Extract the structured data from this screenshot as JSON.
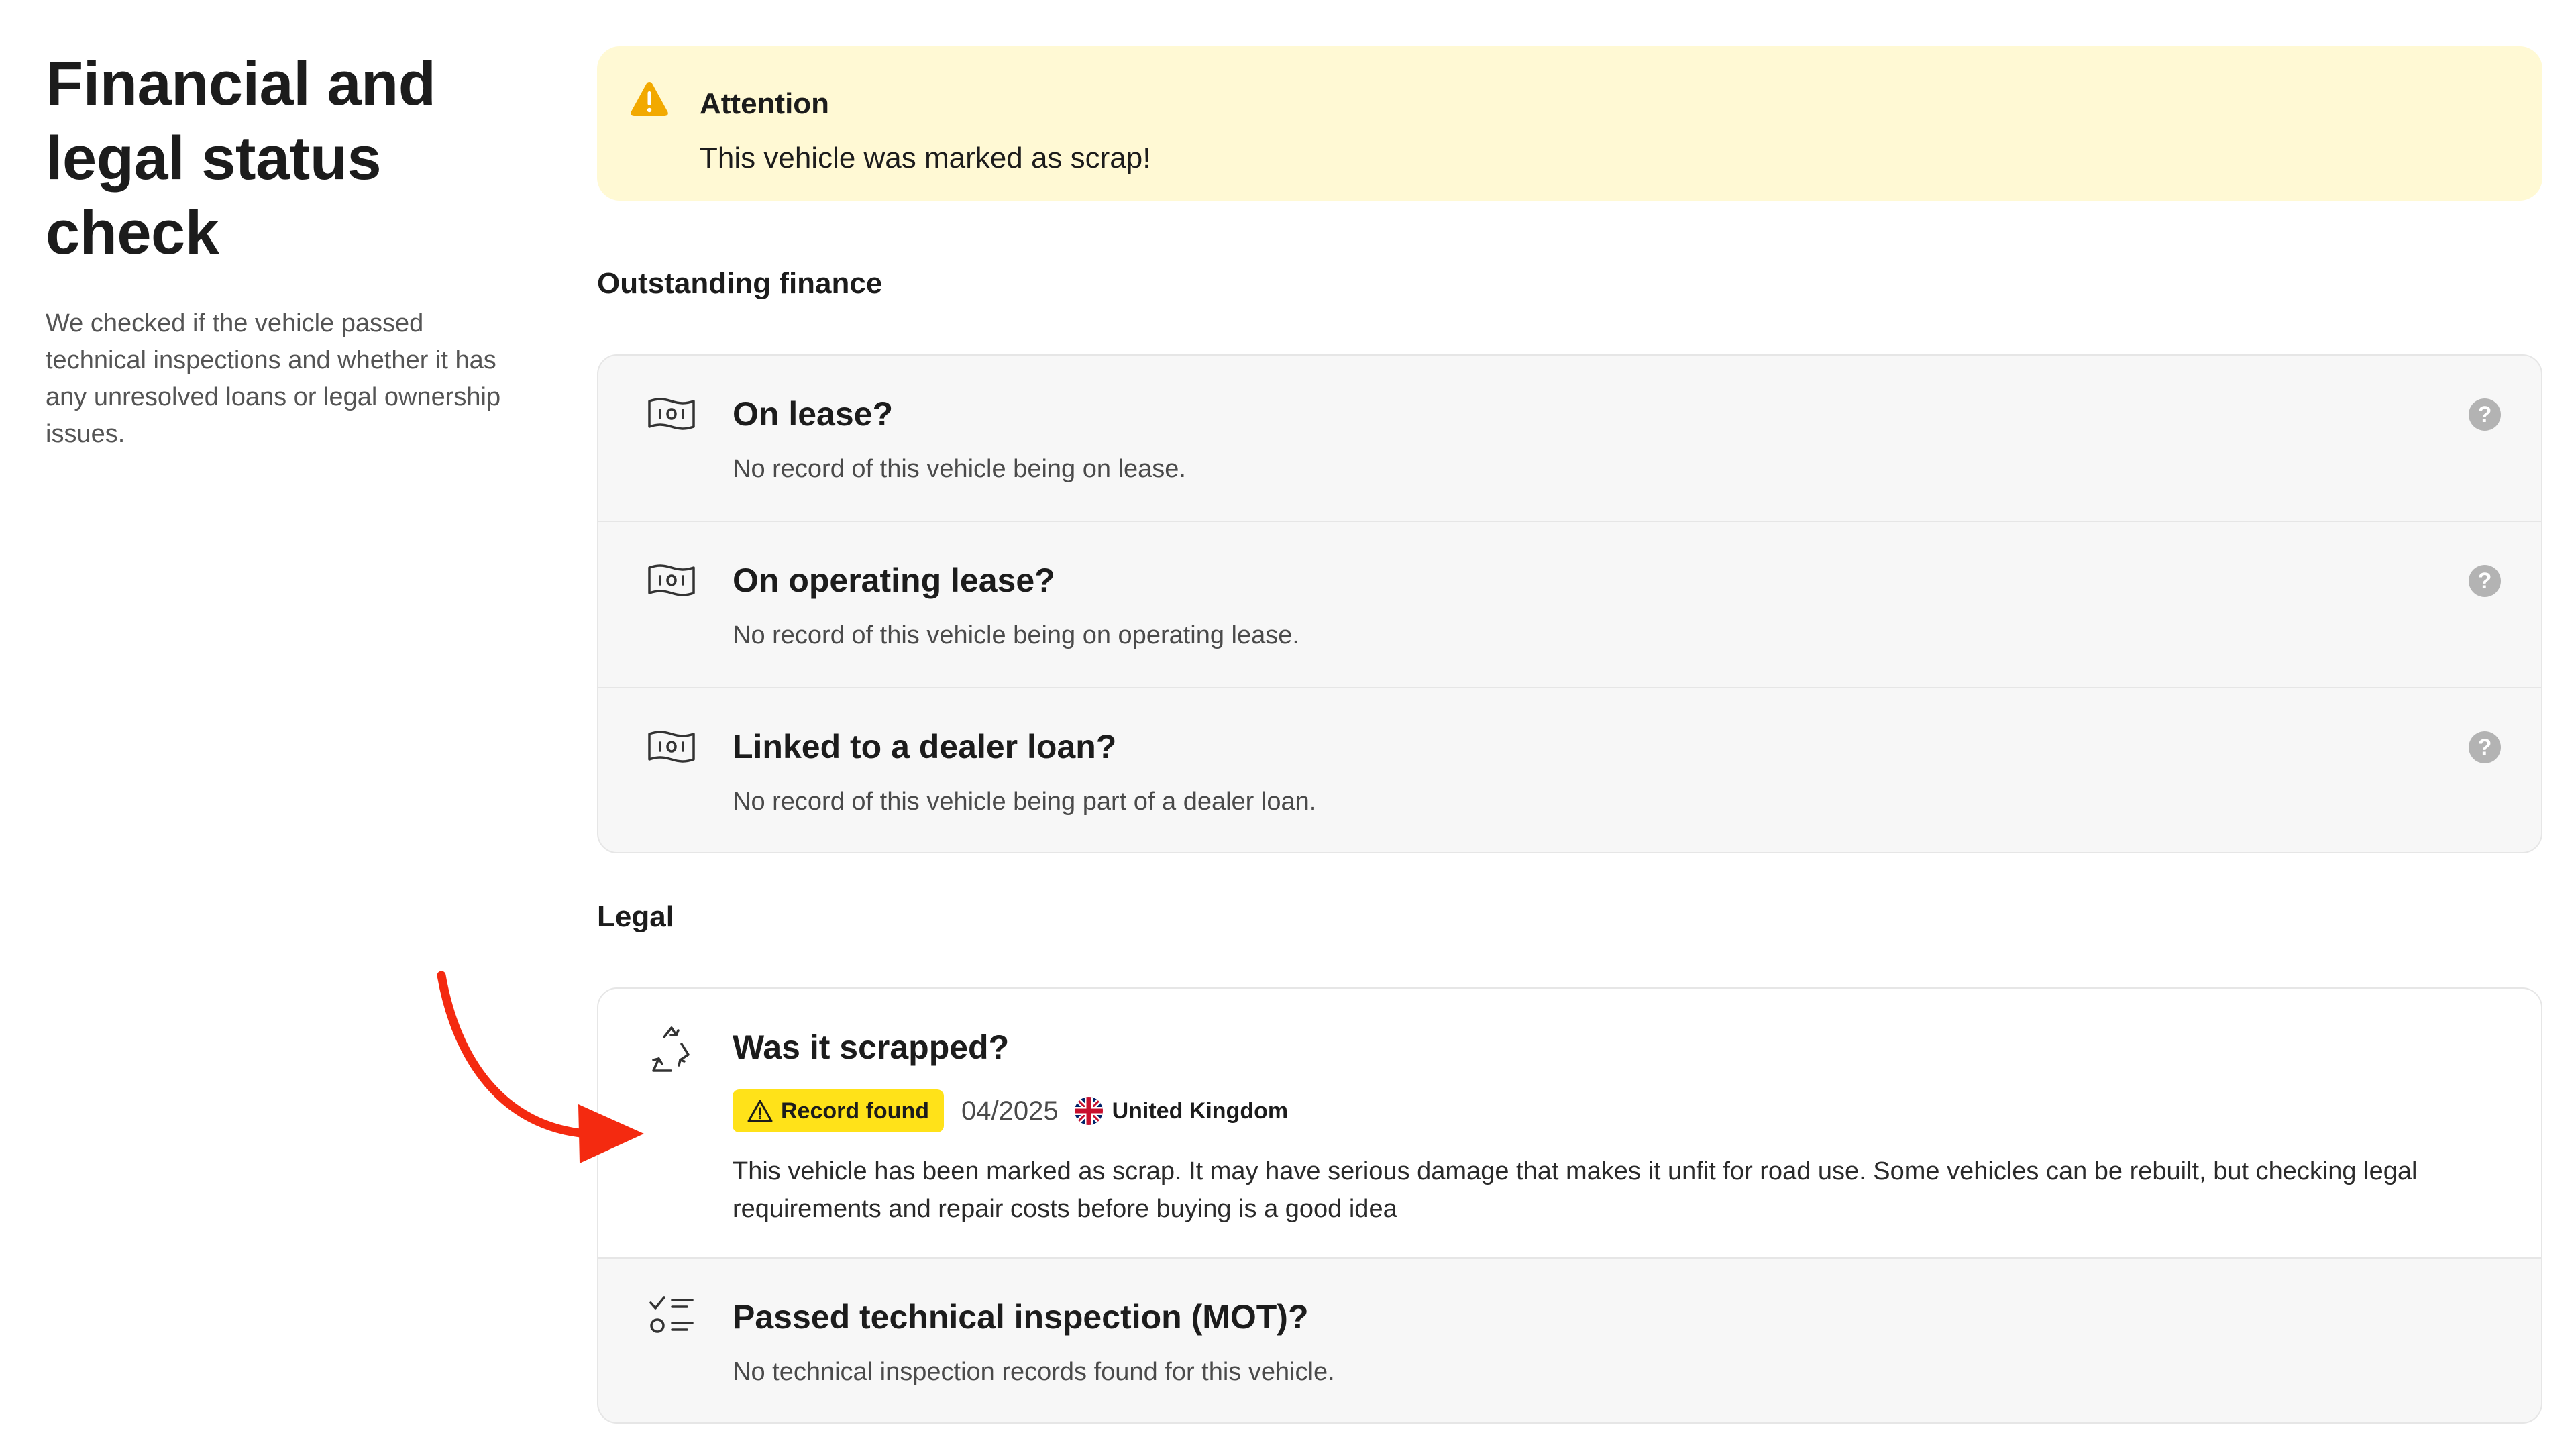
{
  "sidebar": {
    "title_lines": [
      "Financial and",
      "legal status",
      "check"
    ],
    "description": "We checked if the vehicle passed technical inspections and whether it has any unresolved loans or legal ownership issues."
  },
  "alert": {
    "icon": "warning-triangle-icon",
    "title": "Attention",
    "message": "This vehicle was marked as scrap!",
    "background": "#fff9d4",
    "icon_color": "#f2a900"
  },
  "finance": {
    "heading": "Outstanding finance",
    "items": [
      {
        "icon": "banknote-icon",
        "title": "On lease?",
        "description": "No record of this vehicle being on lease.",
        "help": "?"
      },
      {
        "icon": "banknote-icon",
        "title": "On operating lease?",
        "description": "No record of this vehicle being on operating lease.",
        "help": "?"
      },
      {
        "icon": "banknote-icon",
        "title": "Linked to a dealer loan?",
        "description": "No record of this vehicle being part of a dealer loan.",
        "help": "?"
      }
    ]
  },
  "legal": {
    "heading": "Legal",
    "scrapped": {
      "icon": "recycle-icon",
      "title": "Was it scrapped?",
      "badge": "Record found",
      "badge_color": "#ffe219",
      "date": "04/2025",
      "country": "United Kingdom",
      "country_icon": "uk-flag-icon",
      "body": "This vehicle has been marked as scrap. It may have serious damage that makes it unfit for road use. Some vehicles can be rebuilt, but checking legal requirements and repair costs before buying is a good idea"
    },
    "mot": {
      "icon": "checklist-icon",
      "title": "Passed technical inspection (MOT)?",
      "description": "No technical inspection records found for this vehicle."
    }
  },
  "annotation": {
    "arrow_color": "#f42a10"
  }
}
